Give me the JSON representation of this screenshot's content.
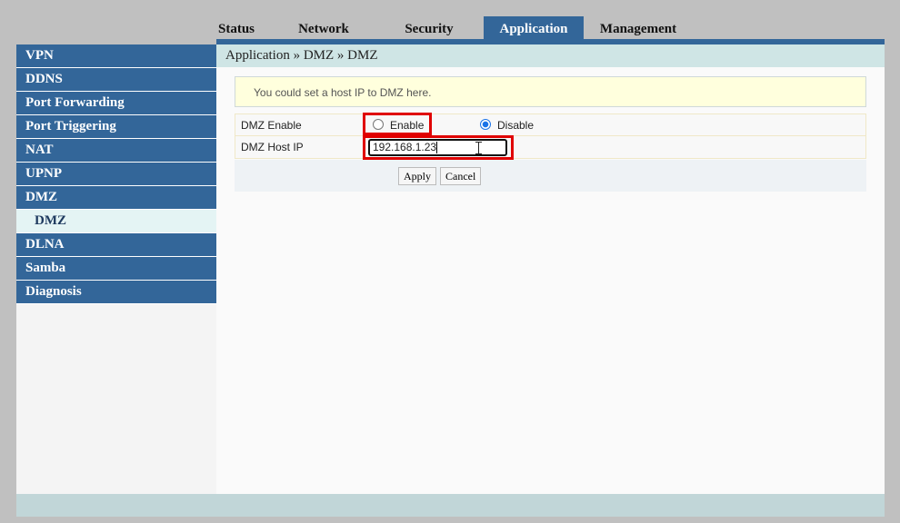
{
  "topnav": {
    "tabs": [
      {
        "label": "Status"
      },
      {
        "label": "Network"
      },
      {
        "label": "Security"
      },
      {
        "label": "Application"
      },
      {
        "label": "Management"
      }
    ],
    "active": "Application"
  },
  "sidebar": {
    "items": [
      {
        "label": "VPN"
      },
      {
        "label": "DDNS"
      },
      {
        "label": "Port Forwarding"
      },
      {
        "label": "Port Triggering"
      },
      {
        "label": "NAT"
      },
      {
        "label": "UPNP"
      },
      {
        "label": "DMZ"
      },
      {
        "label": "DMZ",
        "sub": true,
        "active": true
      },
      {
        "label": "DLNA"
      },
      {
        "label": "Samba"
      },
      {
        "label": "Diagnosis"
      }
    ]
  },
  "breadcrumb": "Application » DMZ » DMZ",
  "notice": "You could set a host IP to DMZ here.",
  "form": {
    "dmz_enable": {
      "label": "DMZ Enable",
      "options": [
        {
          "label": "Enable",
          "checked": false
        },
        {
          "label": "Disable",
          "checked": true
        }
      ]
    },
    "dmz_host_ip": {
      "label": "DMZ Host IP",
      "value": "192.168.1.23"
    }
  },
  "buttons": {
    "apply": "Apply",
    "cancel": "Cancel"
  },
  "colors": {
    "accent": "#336699",
    "highlight": "#e00000"
  }
}
